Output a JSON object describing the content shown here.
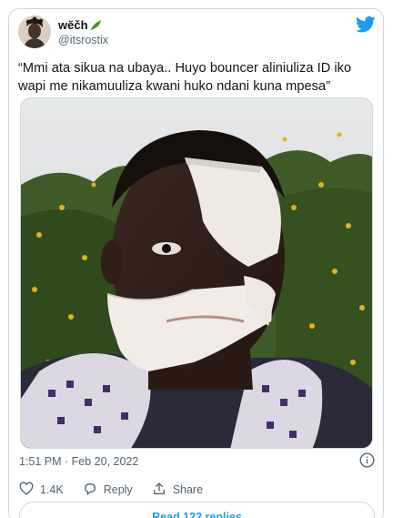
{
  "author": {
    "display_name": "wĕčh",
    "handle": "@itsrostix",
    "verified_icon": "leaf-emoji-icon"
  },
  "tweet": {
    "text": "“Mmi ata sikua na ubaya.. Huyo bouncer aliniuliza ID iko wapi me nikamuuliza kwani huko ndani kuna mpesa”",
    "timestamp": "1:51 PM · Feb 20, 2022"
  },
  "actions": {
    "like_count": "1.4K",
    "reply_label": "Reply",
    "share_label": "Share"
  },
  "read_replies_label": "Read 122 replies",
  "colors": {
    "twitter_blue": "#1d9bf0",
    "border": "#cfd9de",
    "secondary_text": "#536471"
  },
  "icons": [
    "twitter-bird-icon",
    "info-icon",
    "heart-icon",
    "reply-icon",
    "share-icon"
  ]
}
